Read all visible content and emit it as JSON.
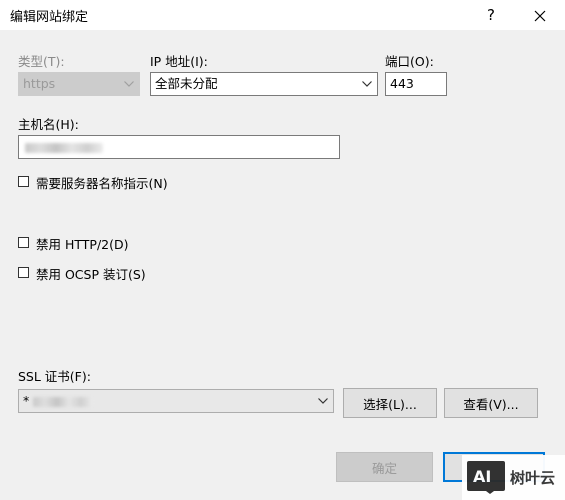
{
  "window": {
    "title": "编辑网站绑定",
    "help_label": "?"
  },
  "type_field": {
    "label": "类型(T):",
    "value": "https"
  },
  "ip_field": {
    "label": "IP 地址(I):",
    "value": "全部未分配"
  },
  "port_field": {
    "label": "端口(O):",
    "value": "443"
  },
  "hostname_field": {
    "label": "主机名(H):",
    "value": ""
  },
  "options": {
    "require_sni": "需要服务器名称指示(N)",
    "disable_http2": "禁用 HTTP/2(D)",
    "disable_ocsp": "禁用 OCSP 装订(S)"
  },
  "ssl": {
    "label": "SSL 证书(F):",
    "value_prefix": "*",
    "select_button": "选择(L)...",
    "view_button": "查看(V)..."
  },
  "footer": {
    "ok_button": "确定"
  },
  "watermark": {
    "logo_text": "AI",
    "brand_text": "树叶云"
  }
}
